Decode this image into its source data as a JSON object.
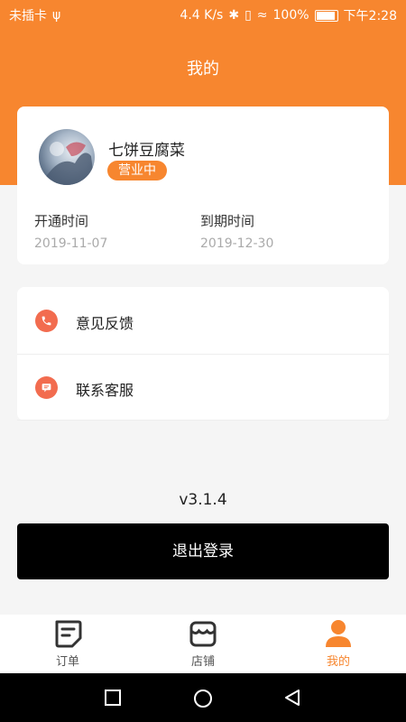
{
  "status_bar": {
    "carrier": "未插卡",
    "usb_symbol": "ψ",
    "speed": "4.4 K/s",
    "bluetooth_symbol": "✱",
    "vibrate_symbol": "▯",
    "wifi_symbol": "≈",
    "battery_percent": "100%",
    "time": "下午2:28"
  },
  "header": {
    "title": "我的"
  },
  "profile": {
    "shop_name": "七饼豆腐菜",
    "status_badge": "营业中",
    "open_label": "开通时间",
    "open_date": "2019-11-07",
    "expire_label": "到期时间",
    "expire_date": "2019-12-30"
  },
  "menu": {
    "items": [
      {
        "label": "意见反馈",
        "icon": "phone-icon"
      },
      {
        "label": "联系客服",
        "icon": "message-icon"
      }
    ]
  },
  "version": "v3.1.4",
  "logout_label": "退出登录",
  "tabbar": {
    "tabs": [
      {
        "label": "订单",
        "icon": "order-icon",
        "active": false
      },
      {
        "label": "店铺",
        "icon": "store-icon",
        "active": false
      },
      {
        "label": "我的",
        "icon": "user-icon",
        "active": true
      }
    ]
  },
  "colors": {
    "accent": "#f7862f",
    "menu_icon": "#f26c4f",
    "background": "#f5f5f5",
    "logout_button": "#000000"
  }
}
